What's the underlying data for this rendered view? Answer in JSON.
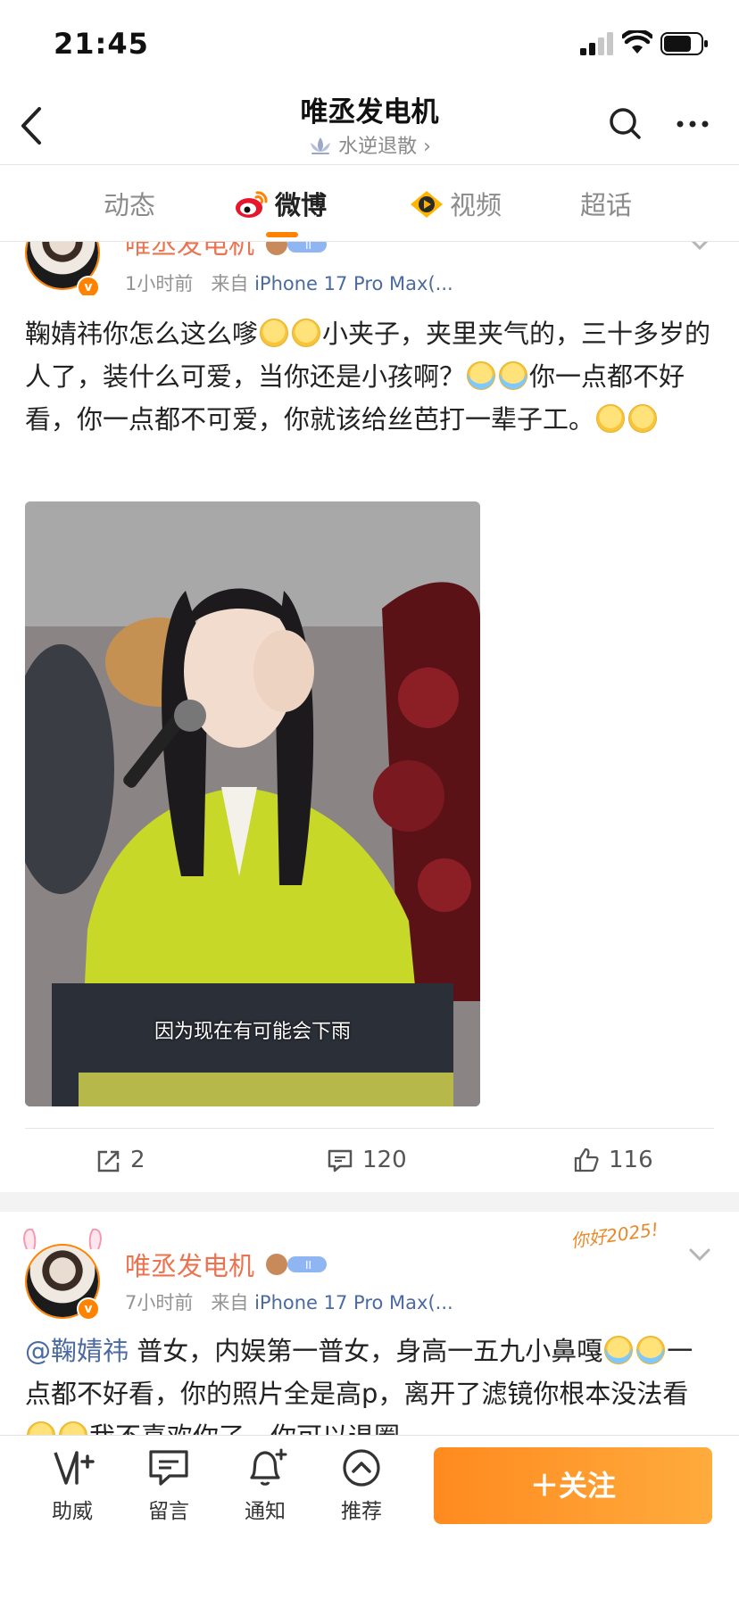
{
  "status_bar": {
    "time": "21:45"
  },
  "header": {
    "title": "唯丞发电机",
    "subtitle": "水逆退散",
    "subtitle_chevron": "›"
  },
  "tabs": [
    {
      "label": "动态",
      "active": false
    },
    {
      "label": "微博",
      "active": true,
      "icon": "weibo-icon"
    },
    {
      "label": "视频",
      "active": false,
      "icon": "video-icon"
    },
    {
      "label": "超话",
      "active": false
    }
  ],
  "posts": [
    {
      "username": "唯丞发电机",
      "time": "1小时前",
      "source_prefix": "来自",
      "source": "iPhone 17 Pro Max(...",
      "text_parts": [
        "鞠婧祎你怎么这么嗲",
        "小夹子，夹里夹气的，三十多岁的人了，装什么可爱，当你还是小孩啊？",
        "你一点都不好看，你一点都不可爱，你就该给丝芭打一辈子工。"
      ],
      "image_caption": "因为现在有可能会下雨",
      "reposts": "2",
      "comments": "120",
      "likes": "116"
    },
    {
      "username": "唯丞发电机",
      "time": "7小时前",
      "source_prefix": "来自",
      "source": "iPhone 17 Pro Max(...",
      "mention": "@鞠婧祎",
      "text_parts": [
        " 普女，内娱第一普女，身高一五九小鼻嘎",
        "一点都不好看，你的照片全是高p，离开了滤镜你根本没法看",
        "我不喜欢你了，你可以退圈"
      ],
      "decoration_text": "你好2025!"
    }
  ],
  "bottom_nav": [
    {
      "label": "助威",
      "icon": "cheer-icon"
    },
    {
      "label": "留言",
      "icon": "message-icon"
    },
    {
      "label": "通知",
      "icon": "bell-icon"
    },
    {
      "label": "推荐",
      "icon": "recommend-icon"
    }
  ],
  "follow_button": "＋关注",
  "colors": {
    "accent": "#ff8200",
    "username": "#eb7350",
    "link": "#4b6aa0"
  }
}
